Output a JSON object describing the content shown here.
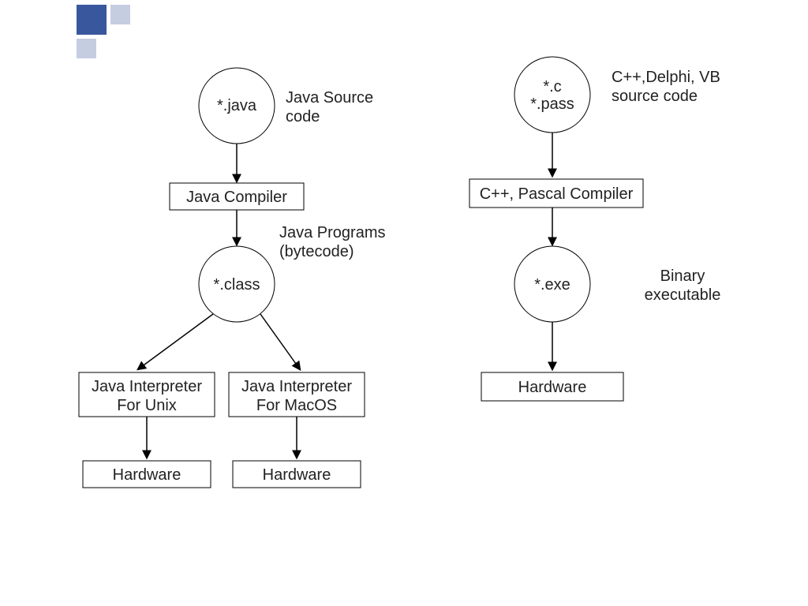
{
  "decor": {
    "color_accent": "#38579d",
    "color_faint": "#c5cde1"
  },
  "left_flow": {
    "source": {
      "ext": "*.java",
      "desc": "Java Source\ncode"
    },
    "compiler": "Java Compiler",
    "bytecode": {
      "ext": "*.class",
      "desc": "Java Programs\n(bytecode)"
    },
    "interp_unix": "Java Interpreter\nFor Unix",
    "interp_mac": "Java Interpreter\nFor MacOS",
    "hw_unix": "Hardware",
    "hw_mac": "Hardware"
  },
  "right_flow": {
    "source": {
      "ext1": "*.c",
      "ext2": "*.pass",
      "desc": "C++,Delphi, VB\nsource code"
    },
    "compiler": "C++, Pascal Compiler",
    "binary": {
      "ext": "*.exe",
      "desc": "Binary\nexecutable"
    },
    "hw": "Hardware"
  }
}
